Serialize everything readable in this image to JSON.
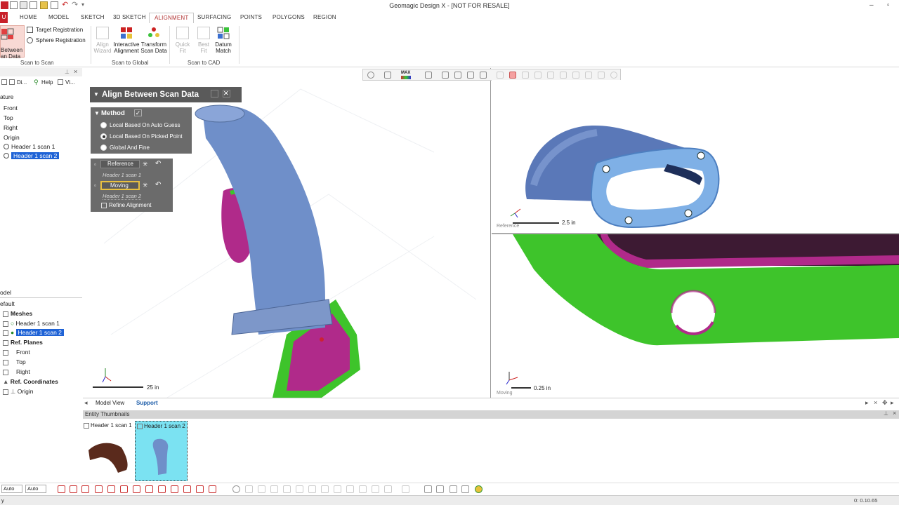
{
  "app": {
    "title": "Geomagic Design X - [NOT FOR RESALE]"
  },
  "ribbon": {
    "tabs": [
      "HOME",
      "MODEL",
      "SKETCH",
      "3D SKETCH",
      "ALIGNMENT",
      "SURFACING",
      "POINTS",
      "POLYGONS",
      "REGION"
    ],
    "active_tab": "ALIGNMENT",
    "file_tab": "U",
    "scan_to_scan": {
      "label": "Scan to Scan",
      "between_label_1": "Between",
      "between_label_2": "an Data",
      "target_registration": "Target Registration",
      "sphere_registration": "Sphere Registration"
    },
    "scan_to_global": {
      "label": "Scan to Global",
      "align_wizard_1": "Align",
      "align_wizard_2": "Wizard",
      "interactive_1": "Interactive",
      "interactive_2": "Alignment",
      "transform_1": "Transform",
      "transform_2": "Scan Data"
    },
    "scan_to_cad": {
      "label": "Scan to CAD",
      "quick_fit_1": "Quick",
      "quick_fit_2": "Fit",
      "best_fit_1": "Best",
      "best_fit_2": "Fit",
      "datum_match_1": "Datum",
      "datum_match_2": "Match"
    }
  },
  "left_top": {
    "toolbar": [
      "Di...",
      "Help",
      "Vi..."
    ],
    "header": "ature",
    "items": [
      "Front",
      "Top",
      "Right",
      "Origin",
      "Header 1 scan 1",
      "Header 1 scan 2"
    ]
  },
  "left_bottom": {
    "header": "odel",
    "sub": "efault",
    "meshes_label": "Meshes",
    "mesh1": "Header 1 scan 1",
    "mesh2": "Header 1 scan 2",
    "ref_planes": "Ref. Planes",
    "front": "Front",
    "top": "Top",
    "right": "Right",
    "ref_coords": "Ref. Coordinates",
    "origin": "Origin"
  },
  "align_panel": {
    "title": "Align Between Scan Data",
    "method_label": "Method",
    "options": [
      "Local Based On Auto Guess",
      "Local Based On Picked Point",
      "Global And Fine"
    ],
    "selected_option": 1,
    "reference_label": "Reference",
    "reference_value": "Header 1 scan 1",
    "moving_label": "Moving",
    "moving_value": "Header 1 scan 2",
    "refine_label": "Refine Alignment"
  },
  "view_toolbar": {
    "max_label": "MAX"
  },
  "viewports": {
    "left_scale": "25 in",
    "top_right_scale": "2.5 in",
    "top_right_tag": "Reference",
    "bottom_right_scale": "0.25 in",
    "bottom_right_tag": "Moving"
  },
  "view_tabs": {
    "model_view": "Model View",
    "support": "Support"
  },
  "thumbnails": {
    "bar_label": "Entity Thumbnails",
    "items": [
      {
        "label": "Header 1 scan 1",
        "checked": true
      },
      {
        "label": "Header 1 scan 2",
        "checked": true
      }
    ]
  },
  "bottom_toolbar": {
    "select1": "Auto",
    "select2": "Auto"
  },
  "status": {
    "left": "y",
    "right": "0: 0.10.65"
  },
  "colors": {
    "accent_red": "#b03030",
    "selection_blue": "#1f63d6",
    "mesh_blue": "#6f8fc9",
    "mesh_green": "#3ec42b",
    "mesh_magenta": "#b02a8a",
    "panel_gray": "#5a5a5a",
    "thumb_highlight": "#7be2f2"
  }
}
